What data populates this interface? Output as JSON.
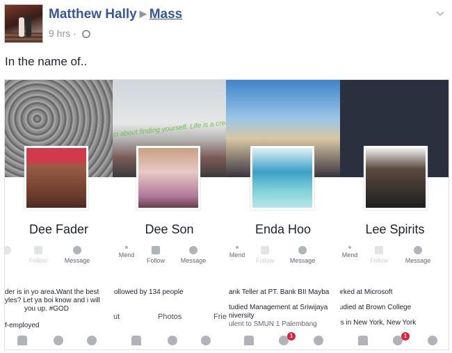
{
  "post": {
    "author": "Matthew Hally",
    "group": "Mass",
    "time": "9 hrs",
    "text": "In the name of.."
  },
  "cards": [
    {
      "name": "Dee Fader",
      "buttons": [
        "nd",
        "Follow",
        "Message"
      ],
      "info": [
        "der is in yo area.Want the best",
        "yles? Let ya boi know and i will",
        "you up. #GOD",
        "f-employed"
      ],
      "cover_text": ""
    },
    {
      "name": "Dee Son",
      "buttons": [
        "Mend",
        "Follow",
        "Message"
      ],
      "info": [
        "ollowed by 134 people"
      ],
      "cover_text": "ct about finding yourself. Life is a creating yourself."
    },
    {
      "name": "Enda Hoo",
      "buttons": [
        "Mend",
        "Follow",
        "Message"
      ],
      "info": [
        "ank Teller at PT. Bank BII Mayba",
        "tudied Management at Sriwijaya",
        "niversity",
        "ulent to SMUN 1 Palembang"
      ],
      "cover_text": ""
    },
    {
      "name": "Lee Spirits",
      "buttons": [
        "Mend",
        "Follow",
        "Message"
      ],
      "info": [
        "orked at Microsoft",
        "tudied at Brown College",
        "ives in New York, New York"
      ],
      "cover_text": ""
    }
  ],
  "subnav": [
    "ut",
    "Photos",
    "Frie"
  ],
  "badges": [
    "1",
    "1"
  ],
  "colors": {
    "link": "#365899",
    "meta": "#90949c",
    "badge": "#e41e3f"
  }
}
